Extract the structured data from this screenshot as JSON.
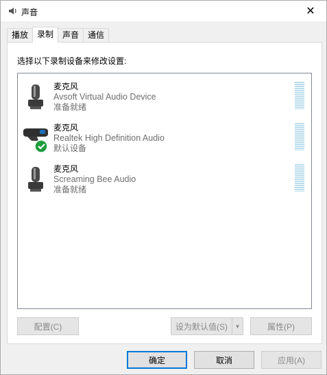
{
  "window": {
    "title": "声音",
    "close_label": "✕"
  },
  "tabs": [
    {
      "label": "播放",
      "active": false
    },
    {
      "label": "录制",
      "active": true
    },
    {
      "label": "声音",
      "active": false
    },
    {
      "label": "通信",
      "active": false
    }
  ],
  "panel": {
    "instruction": "选择以下录制设备来修改设置:"
  },
  "devices": [
    {
      "type": "麦克风",
      "name": "Avsoft Virtual Audio Device",
      "status": "准备就绪",
      "icon": "microphone-icon",
      "default": false
    },
    {
      "type": "麦克风",
      "name": "Realtek High Definition Audio",
      "status": "默认设备",
      "icon": "webcam-microphone-icon",
      "default": true
    },
    {
      "type": "麦克风",
      "name": "Screaming Bee Audio",
      "status": "准备就绪",
      "icon": "microphone-icon",
      "default": false
    }
  ],
  "panel_buttons": {
    "configure": "配置(C)",
    "set_default": "设为默认值(S)",
    "set_default_arrow": "▼",
    "properties": "属性(P)"
  },
  "dialog_buttons": {
    "ok": "确定",
    "cancel": "取消",
    "apply": "应用(A)"
  },
  "colors": {
    "accent": "#0078d7",
    "level_meter": "#b9dcea",
    "default_check": "#1e9e3e"
  }
}
